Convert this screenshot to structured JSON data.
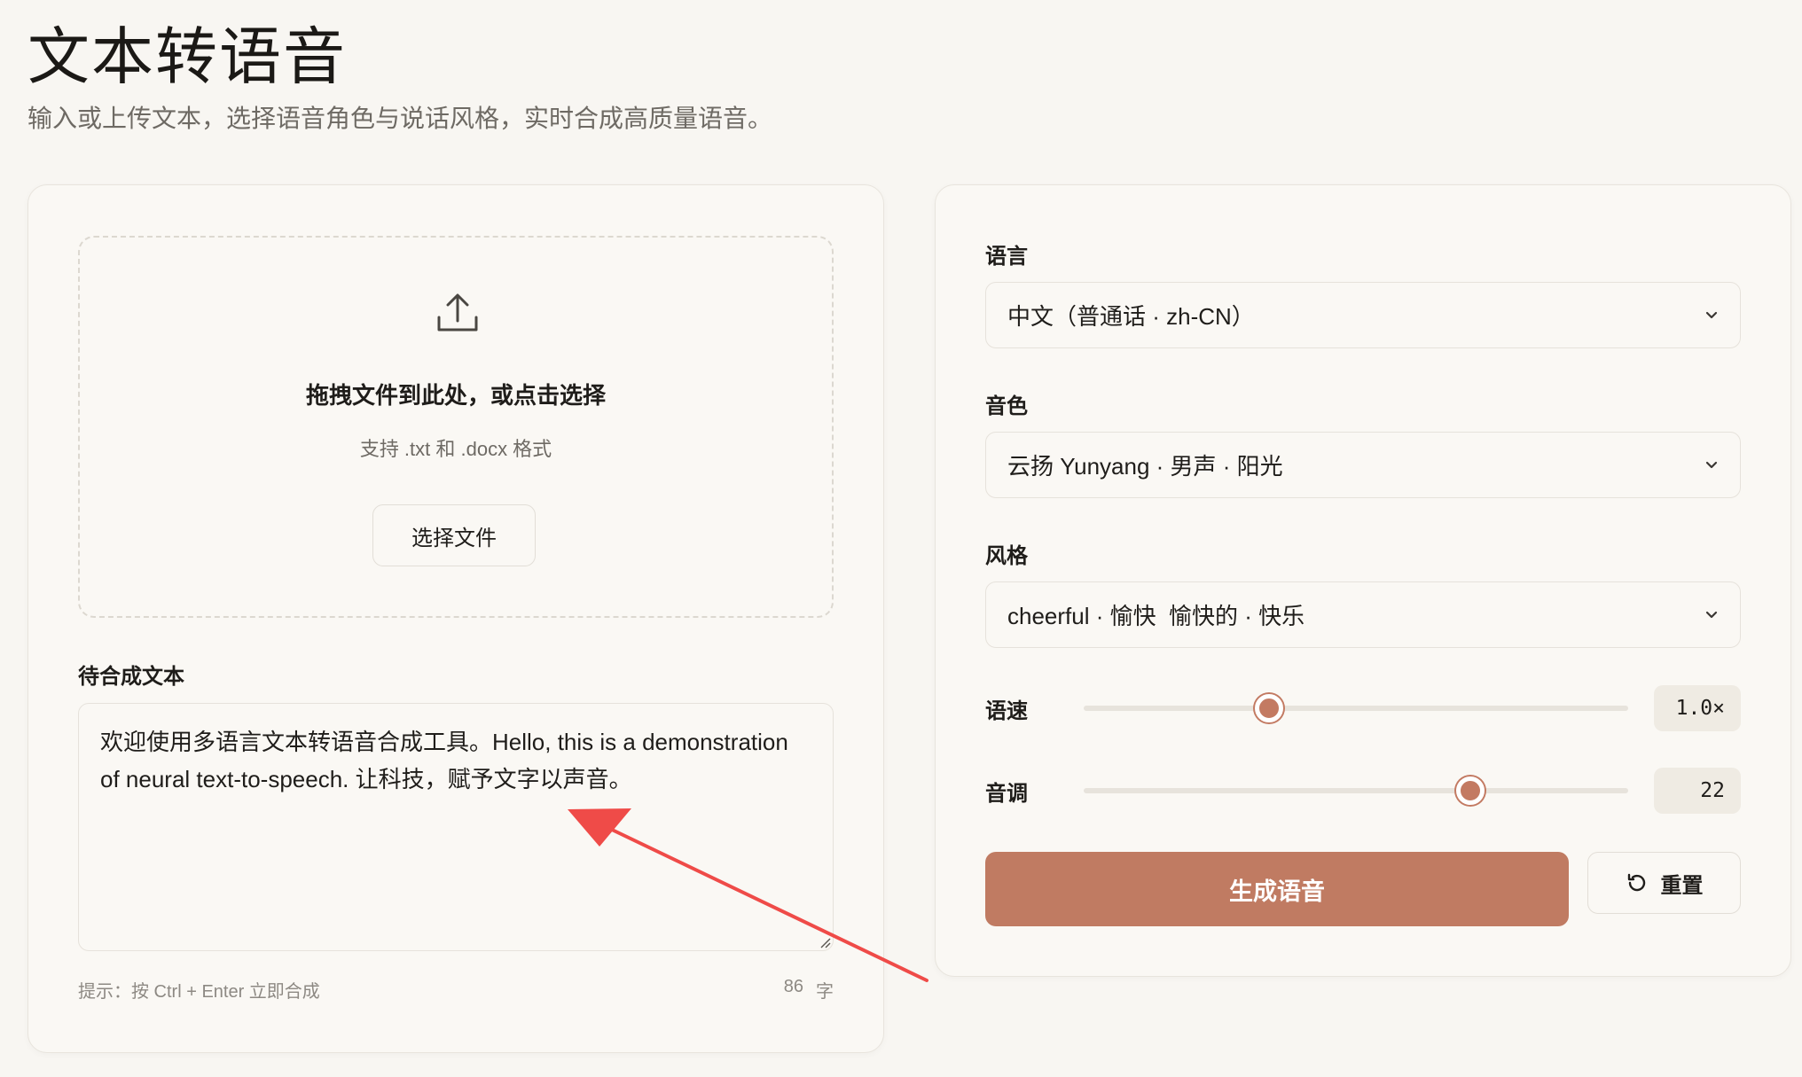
{
  "header": {
    "title": "文本转语音",
    "subtitle": "输入或上传文本，选择语音角色与说话风格，实时合成高质量语音。"
  },
  "upload": {
    "title": "拖拽文件到此处，或点击选择",
    "hint": "支持 .txt 和 .docx 格式",
    "button_label": "选择文件",
    "icon": "upload-icon"
  },
  "editor": {
    "label": "待合成文本",
    "value": "欢迎使用多语言文本转语音合成工具。Hello, this is a demonstration of neural text-to-speech. 让科技，赋予文字以声音。",
    "tip": "提示：按 Ctrl + Enter 立即合成",
    "char_count": "86",
    "char_unit": "字"
  },
  "settings": {
    "language": {
      "label": "语言",
      "value": "中文（普通话 · zh-CN）"
    },
    "voice": {
      "label": "音色",
      "value": "云扬 Yunyang · 男声 · 阳光"
    },
    "style": {
      "label": "风格",
      "value": "cheerful · 愉快  愉快的 · 快乐"
    },
    "speed": {
      "label": "语速",
      "display": "1.0×",
      "fraction": 0.34
    },
    "pitch": {
      "label": "音调",
      "display": "22",
      "fraction": 0.71
    }
  },
  "actions": {
    "generate_label": "生成语音",
    "reset_label": "重置",
    "reset_icon": "rotate-ccw-icon"
  },
  "colors": {
    "accent": "#c07b62",
    "background": "#f8f6f2",
    "annotation_arrow": "#ef4b48"
  }
}
